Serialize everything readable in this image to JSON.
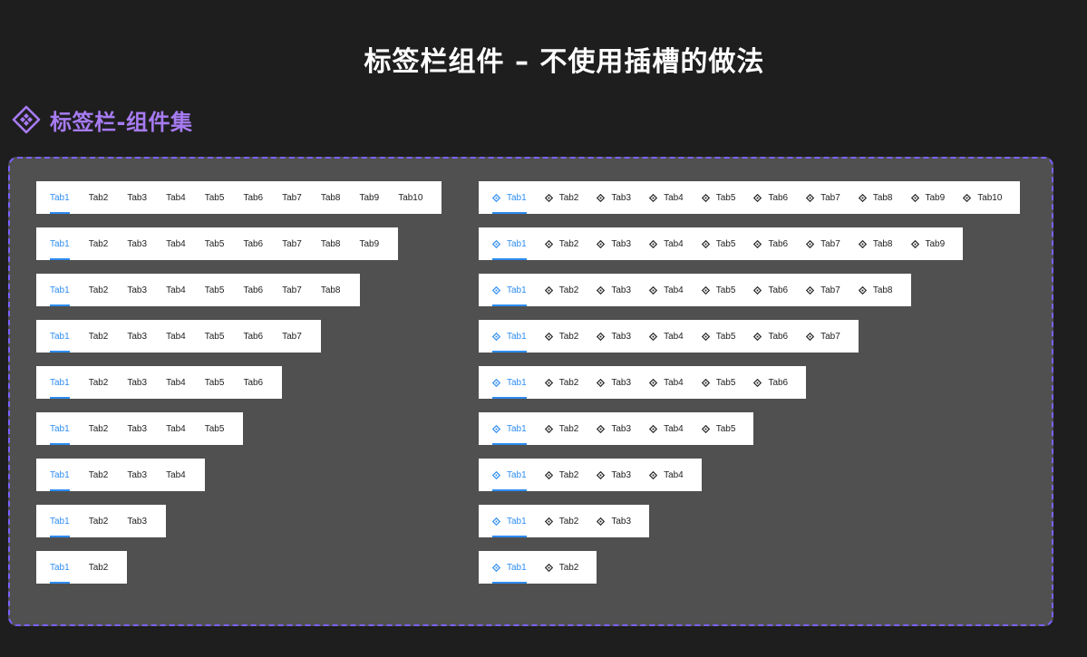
{
  "page": {
    "title": "标签栏组件 – 不使用插槽的做法"
  },
  "component_set": {
    "title": "标签栏-组件集",
    "icon": "component-set-diamond-icon"
  },
  "tabbar": {
    "active_color": "#2d8cf0",
    "tab_icon": "diamond-component-icon",
    "tabs": [
      "Tab1",
      "Tab2",
      "Tab3",
      "Tab4",
      "Tab5",
      "Tab6",
      "Tab7",
      "Tab8",
      "Tab9",
      "Tab10"
    ],
    "variant_tab_counts": [
      10,
      9,
      8,
      7,
      6,
      5,
      4,
      3,
      2
    ],
    "active_tab_index": 0
  }
}
